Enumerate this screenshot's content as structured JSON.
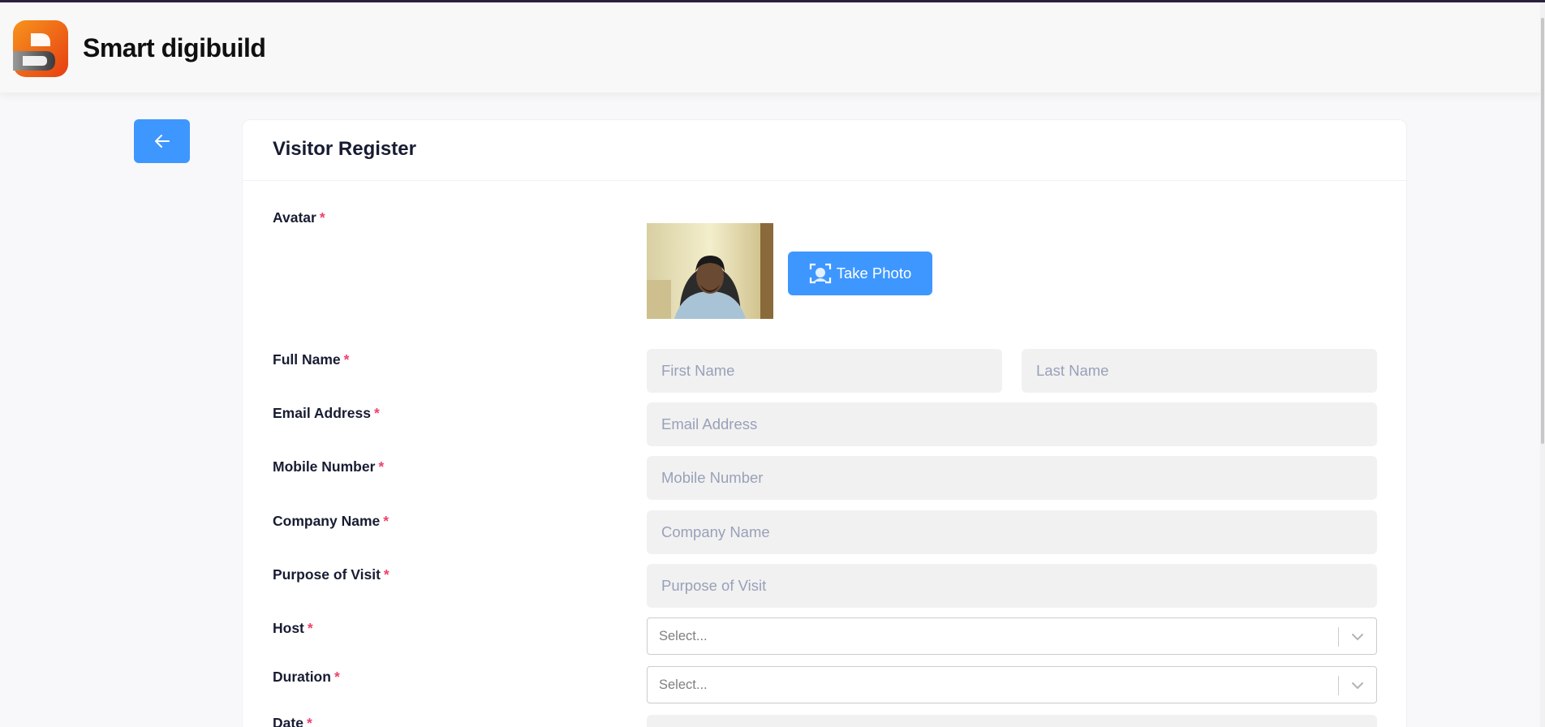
{
  "header": {
    "brand": "Smart digibuild"
  },
  "page": {
    "title": "Visitor Register"
  },
  "form": {
    "avatar_label": "Avatar",
    "take_photo_label": "Take Photo",
    "full_name_label": "Full Name",
    "first_name_placeholder": "First Name",
    "last_name_placeholder": "Last Name",
    "email_label": "Email Address",
    "email_placeholder": "Email Address",
    "mobile_label": "Mobile Number",
    "mobile_placeholder": "Mobile Number",
    "company_label": "Company Name",
    "company_placeholder": "Company Name",
    "purpose_label": "Purpose of Visit",
    "purpose_placeholder": "Purpose of Visit",
    "host_label": "Host",
    "host_placeholder": "Select...",
    "duration_label": "Duration",
    "duration_placeholder": "Select...",
    "date_label": "Date",
    "required_mark": "*"
  },
  "colors": {
    "primary": "#3e97ff",
    "required": "#f1416c",
    "logo_orange": "#f05a1a"
  }
}
